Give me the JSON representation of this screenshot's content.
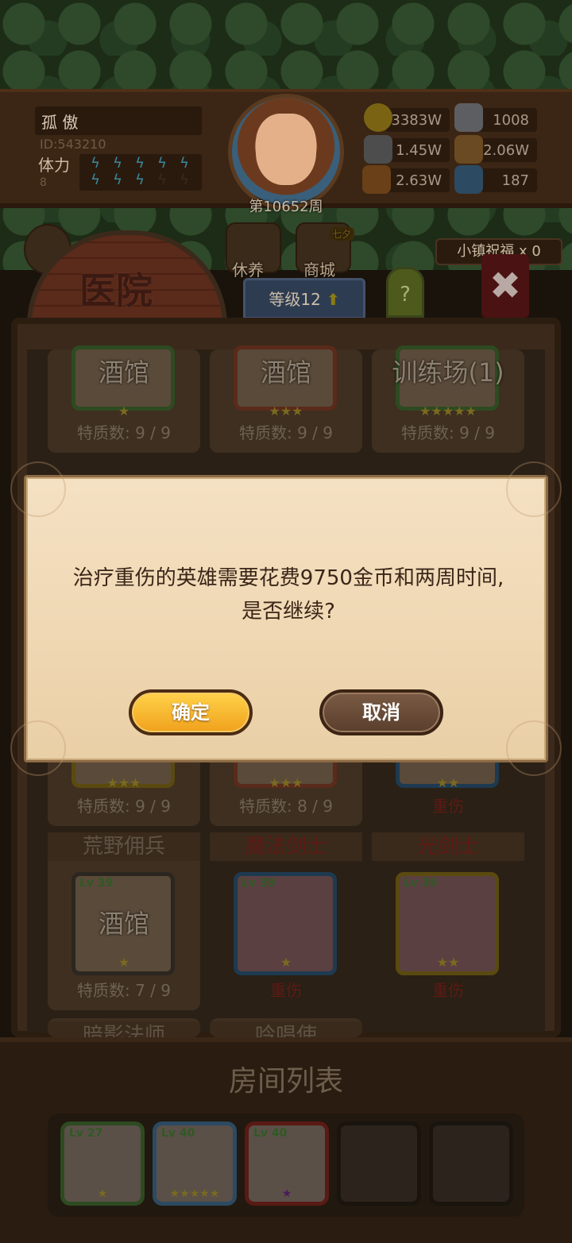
{
  "header": {
    "player_name": "孤 傲",
    "player_id": "ID:543210",
    "stamina_label": "体力",
    "stamina_value": "8",
    "stamina_full": 8,
    "stamina_max": 10,
    "week": "第10652周"
  },
  "resources": {
    "gold": "3383W",
    "iron": "1008",
    "stone": "1.45W",
    "leather": "2.06W",
    "wood": "2.63W",
    "crystal": "187"
  },
  "nav": {
    "rest_label": "休养",
    "shop_label": "商城",
    "shop_badge": "七夕",
    "town_blessing": "小镇祝福 x 0"
  },
  "building": {
    "title": "医院",
    "level": "等级12",
    "help": "?",
    "close": "✖"
  },
  "cards_row1": [
    {
      "place": "酒馆",
      "trait": "特质数: 9 / 9",
      "stars": "★"
    },
    {
      "place": "酒馆",
      "trait": "特质数: 9 / 9",
      "stars": "★★★"
    },
    {
      "place": "训练场(1)",
      "trait": "特质数: 9 / 9",
      "stars": "★★★★★"
    }
  ],
  "cards_row2": [
    {
      "trait": "特质数: 9 / 9",
      "stars": "★★★"
    },
    {
      "trait": "特质数: 8 / 9",
      "stars": "★★★"
    },
    {
      "trait": "重伤",
      "stars": "★★"
    }
  ],
  "cards_row3": [
    {
      "title": "荒野佣兵",
      "lv": "Lv 39",
      "place": "酒馆",
      "trait": "特质数: 7 / 9",
      "stars": "★"
    },
    {
      "title": "魔法剑士",
      "lv": "Lv 39",
      "place": "",
      "trait": "重伤",
      "stars": "★"
    },
    {
      "title": "光剑士",
      "lv": "Lv 39",
      "place": "",
      "trait": "重伤",
      "stars": "★★"
    }
  ],
  "cards_row4": [
    "暗影法师",
    "吟唱使"
  ],
  "room_list": {
    "title": "房间列表",
    "slots": [
      {
        "lv": "Lv 27",
        "stars": "★"
      },
      {
        "lv": "Lv 40",
        "stars": "★★★★★"
      },
      {
        "lv": "Lv 40",
        "stars": "★"
      },
      {
        "lv": "",
        "stars": ""
      },
      {
        "lv": "",
        "stars": ""
      }
    ]
  },
  "dialog": {
    "message_line1": "治疗重伤的英雄需要花费9750金币和两周时间,",
    "message_line2": "是否继续?",
    "confirm_label": "确定",
    "cancel_label": "取消"
  },
  "colors": {
    "confirm_button": "#f0a01c",
    "cancel_button": "#5a3e2c",
    "dialog_bg": "#efd7b2"
  }
}
